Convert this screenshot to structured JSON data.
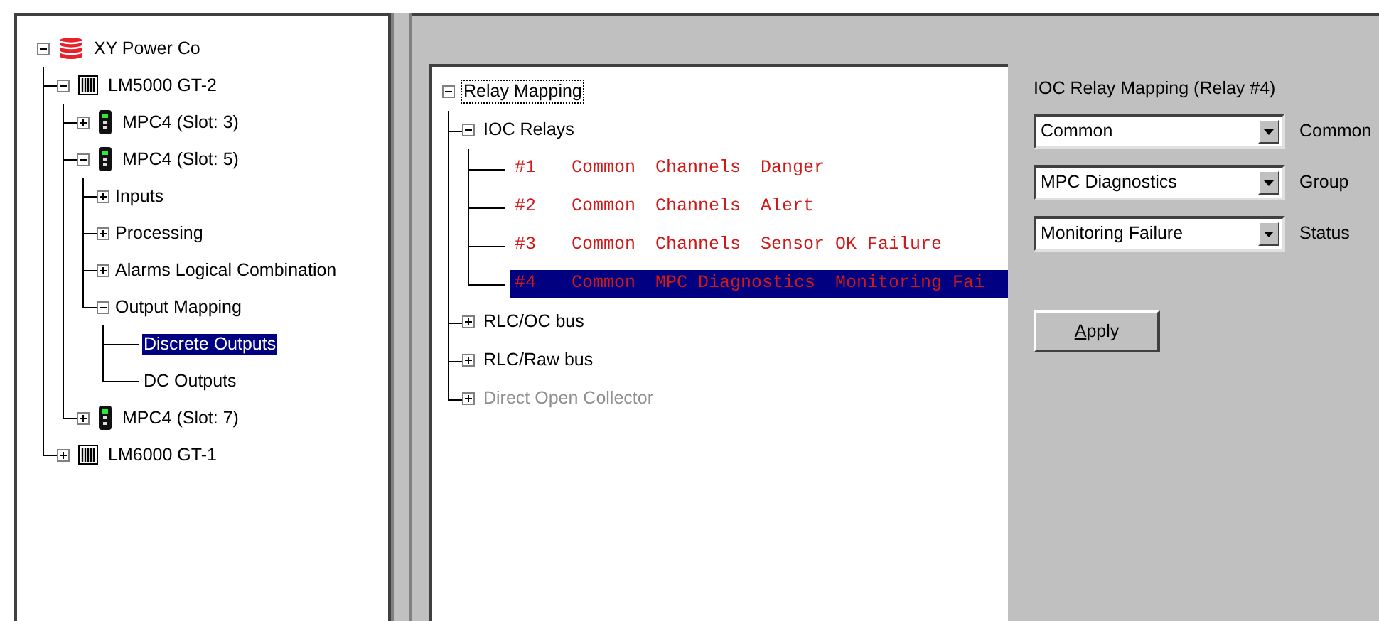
{
  "device_tree": [
    {
      "label": "XY Power Co",
      "kind": "database",
      "expanded": true,
      "selected": false,
      "children": [
        {
          "label": "LM5000 GT-2",
          "kind": "rack",
          "expanded": true,
          "selected": false,
          "children": [
            {
              "label": "MPC4 (Slot:  3)",
              "kind": "card",
              "expanded": false,
              "selected": false
            },
            {
              "label": "MPC4 (Slot:  5)",
              "kind": "card",
              "expanded": true,
              "selected": false,
              "children": [
                {
                  "label": "Inputs",
                  "expanded": false,
                  "selected": false
                },
                {
                  "label": "Processing",
                  "expanded": false,
                  "selected": false
                },
                {
                  "label": "Alarms Logical Combination",
                  "expanded": false,
                  "selected": false
                },
                {
                  "label": "Output Mapping",
                  "expanded": true,
                  "selected": false,
                  "children": [
                    {
                      "label": "Discrete Outputs",
                      "selected": true
                    },
                    {
                      "label": "DC Outputs",
                      "selected": false
                    }
                  ]
                }
              ]
            },
            {
              "label": "MPC4 (Slot:  7)",
              "kind": "card",
              "expanded": false,
              "selected": false
            }
          ]
        },
        {
          "label": "LM6000 GT-1",
          "kind": "rack",
          "expanded": false,
          "selected": false
        }
      ]
    }
  ],
  "relay_tree": [
    {
      "kind": "group",
      "label": "Relay Mapping",
      "expanded": true,
      "focused": true,
      "disabled": false,
      "children": [
        {
          "kind": "group",
          "label": "IOC Relays",
          "expanded": true,
          "focused": false,
          "disabled": false,
          "children": [
            {
              "kind": "relay",
              "cells": [
                "#1",
                "Common",
                "Channels",
                "Danger"
              ],
              "selected": false
            },
            {
              "kind": "relay",
              "cells": [
                "#2",
                "Common",
                "Channels",
                "Alert"
              ],
              "selected": false
            },
            {
              "kind": "relay",
              "cells": [
                "#3",
                "Common",
                "Channels",
                "Sensor OK Failure"
              ],
              "selected": false
            },
            {
              "kind": "relay",
              "cells": [
                "#4",
                "Common",
                "MPC Diagnostics",
                "Monitoring Fai"
              ],
              "selected": true
            }
          ]
        },
        {
          "kind": "group",
          "label": "RLC/OC bus",
          "expanded": false,
          "focused": false,
          "disabled": false
        },
        {
          "kind": "group",
          "label": "RLC/Raw bus",
          "expanded": false,
          "focused": false,
          "disabled": false
        },
        {
          "kind": "group",
          "label": "Direct Open Collector",
          "expanded": false,
          "focused": false,
          "disabled": true
        }
      ]
    }
  ],
  "mapping_form": {
    "title": "IOC Relay Mapping (Relay #4)",
    "fields": [
      {
        "value": "Common",
        "label": "Common"
      },
      {
        "value": "MPC Diagnostics",
        "label": "Group"
      },
      {
        "value": "Monitoring Failure",
        "label": "Status"
      }
    ],
    "apply_button": {
      "mnemonic": "A",
      "rest": "pply"
    }
  }
}
